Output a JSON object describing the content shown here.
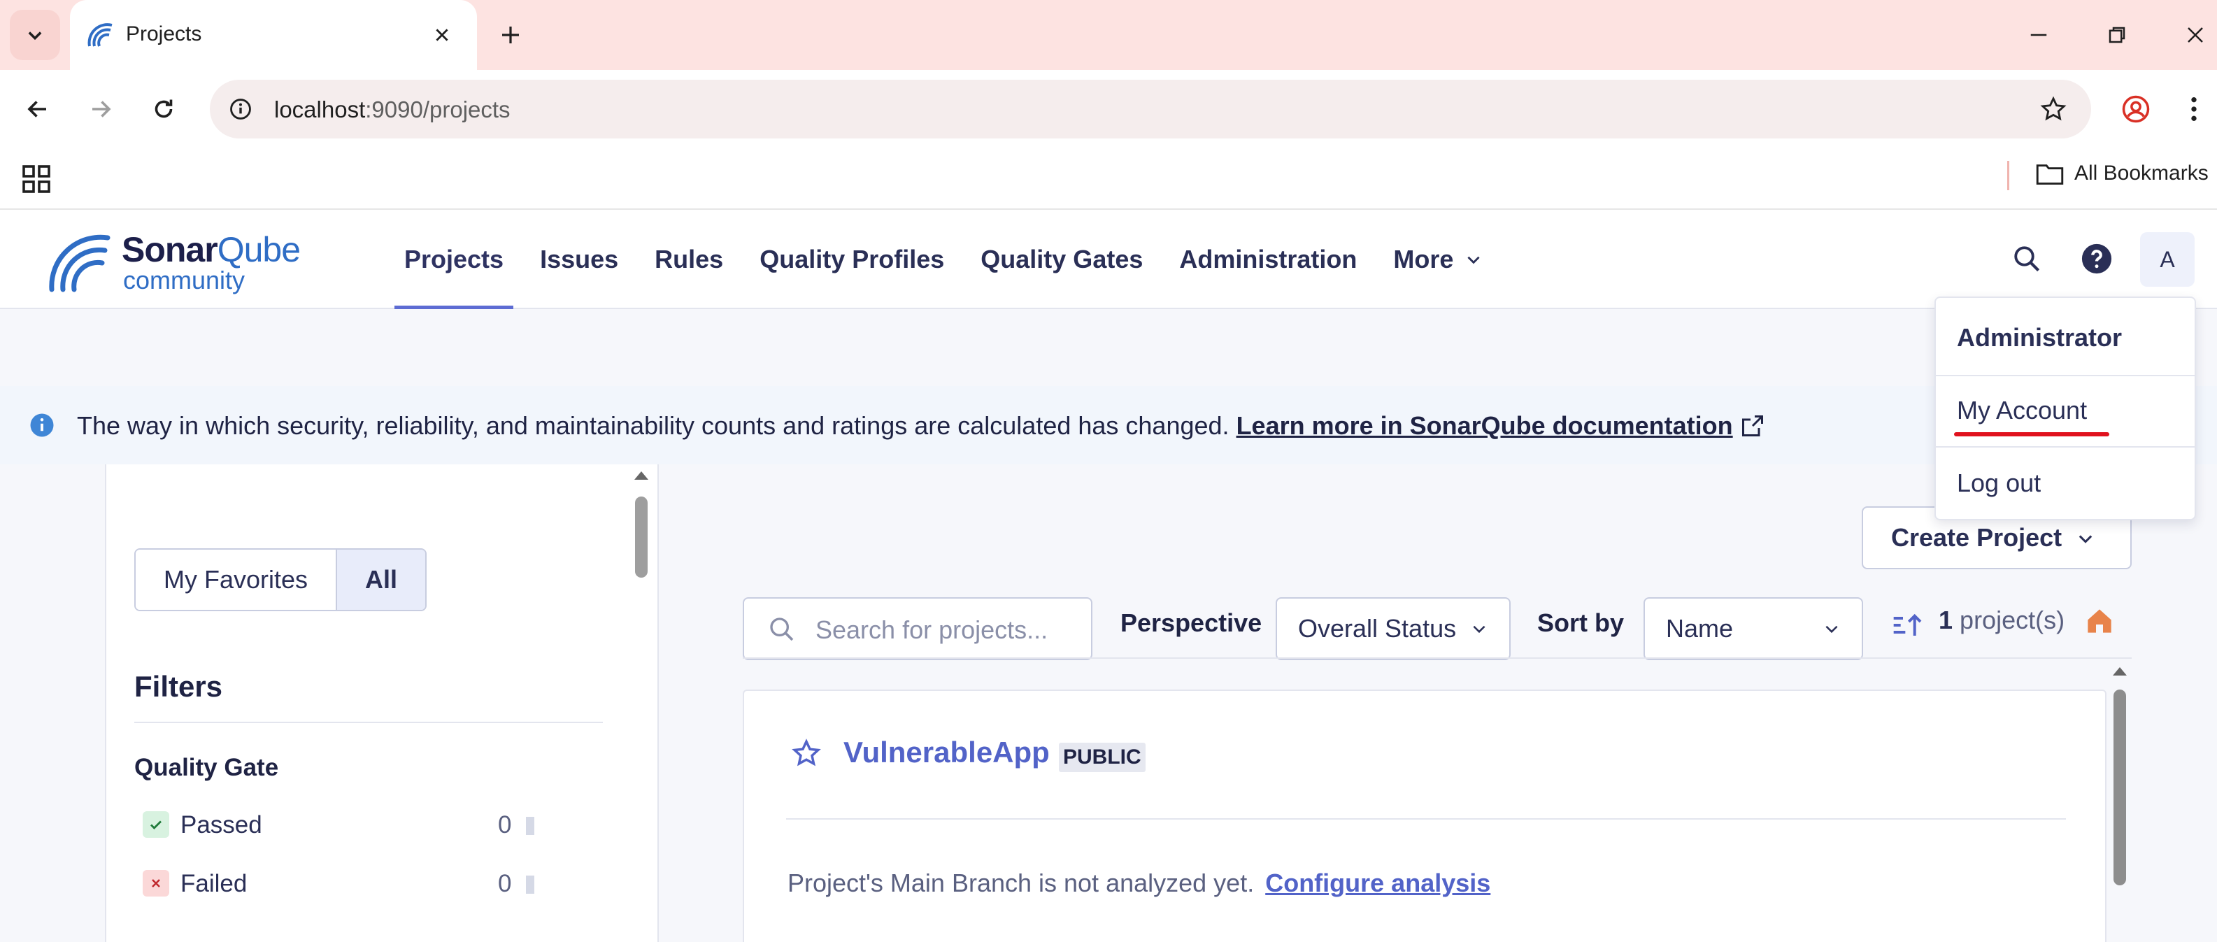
{
  "browser": {
    "tab_title": "Projects",
    "url_host": "localhost",
    "url_path": ":9090/projects",
    "all_bookmarks": "All Bookmarks"
  },
  "header": {
    "brand": "Sonar",
    "brand_suffix": "Qube",
    "edition": "community",
    "nav": [
      "Projects",
      "Issues",
      "Rules",
      "Quality Profiles",
      "Quality Gates",
      "Administration",
      "More"
    ],
    "avatar_initial": "A"
  },
  "account_menu": {
    "user": "Administrator",
    "my_account": "My Account",
    "log_out": "Log out"
  },
  "banner": {
    "text": "The way in which security, reliability, and maintainability counts and ratings are calculated has changed.",
    "link": "Learn more in SonarQube documentation"
  },
  "sidebar": {
    "favorites": "My Favorites",
    "all": "All",
    "filters_title": "Filters",
    "quality_gate_title": "Quality Gate",
    "quality_gate_items": [
      {
        "label": "Passed",
        "count": "0"
      },
      {
        "label": "Failed",
        "count": "0"
      }
    ]
  },
  "main": {
    "create_project": "Create Project",
    "search_placeholder": "Search for projects...",
    "perspective_label": "Perspective",
    "perspective_value": "Overall Status",
    "sort_label": "Sort by",
    "sort_value": "Name",
    "count_value": "1",
    "count_suffix": "project(s)",
    "project": {
      "name": "VulnerableApp",
      "visibility": "PUBLIC",
      "message": "Project's Main Branch is not analyzed yet.",
      "configure": "Configure analysis"
    }
  },
  "colors": {
    "accent": "#5d6cd3",
    "link": "#5263c8",
    "highlight": "#e0121e"
  }
}
